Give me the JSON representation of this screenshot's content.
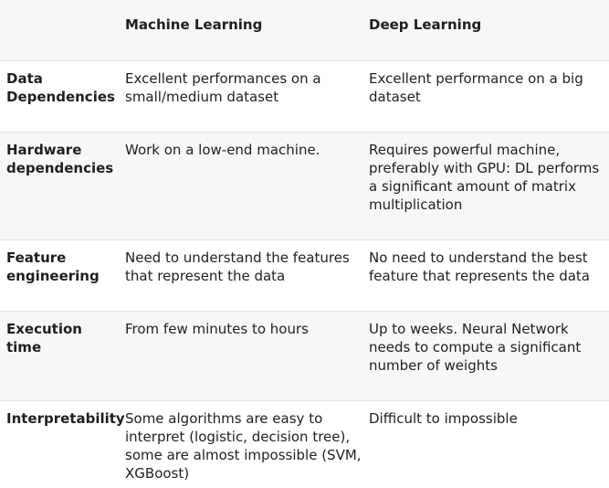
{
  "table": {
    "headers": [
      "",
      "Machine Learning",
      "Deep Learning"
    ],
    "rows": [
      {
        "label": "Data Dependencies",
        "ml": "Excellent performances on a small/medium dataset",
        "dl": "Excellent performance on a big dataset"
      },
      {
        "label": "Hardware dependencies",
        "ml": "Work on a low-end machine.",
        "dl": "Requires powerful machine, preferably with GPU: DL performs a significant amount of matrix multiplication"
      },
      {
        "label": "Feature engineering",
        "ml": "Need to understand the features that represent the data",
        "dl": "No need to understand the best feature that represents the data"
      },
      {
        "label": "Execution time",
        "ml": "From few minutes to hours",
        "dl": "Up to weeks. Neural Network needs to compute a significant number of weights"
      },
      {
        "label": "Interpretability",
        "ml": "Some algorithms are easy to interpret (logistic, decision tree), some are almost impossible (SVM, XGBoost)",
        "dl": "Difficult to impossible"
      }
    ]
  }
}
